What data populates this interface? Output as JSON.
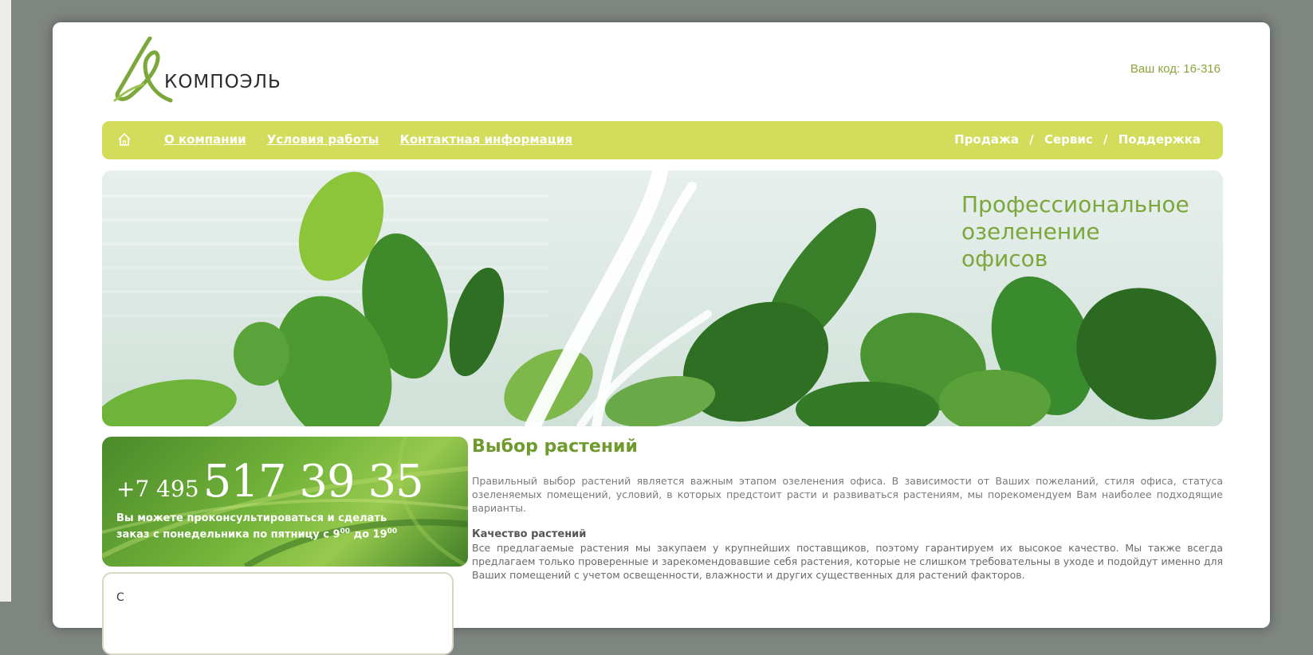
{
  "header": {
    "logo_text": "КОМПОЭЛЬ",
    "user_code": "Ваш код: 16-316"
  },
  "nav": {
    "home_icon": "home-icon",
    "left_links": [
      "О компании",
      "Условия работы",
      "Контактная информация"
    ],
    "right_links": [
      "Продажа",
      "Сервис",
      "Поддержка"
    ],
    "separator": "/"
  },
  "banner": {
    "title": "Профессиональное\nозеленение\nофисов"
  },
  "phone": {
    "code": "+7 495",
    "number": "517 39 35",
    "note_line1": "Вы можете проконсультироваться и сделать",
    "note_line2_prefix": "заказ с понедельника по пятницу с 9",
    "note_sup1": "00",
    "note_mid": " до 19",
    "note_sup2": "00"
  },
  "sidebar_box": {
    "text": "С"
  },
  "content": {
    "title": "Выбор растений",
    "paragraph1": "Правильный выбор растений является важным этапом озеленения офиса. В зависимости от Ваших пожеланий, стиля офиса, статуса озеленяемых помещений, условий, в которых предстоит расти и развиваться растениям, мы порекомендуем Вам наиболее подходящие варианты.",
    "section_title": "Качество растений",
    "paragraph2": "Все предлагаемые растения мы закупаем у крупнейших поставщиков, поэтому гарантируем их высокое качество. Мы также всегда предлагаем только проверенные и зарекомендовавшие себя растения, которые не слишком требовательны в уходе и подойдут именно для Ваших помещений с учетом освещенности, влажности и других существенных для растений факторов."
  },
  "colors": {
    "accent_green": "#6f9a2e",
    "nav_bg": "#d4dc5c",
    "outer_bg": "#7f8580"
  }
}
